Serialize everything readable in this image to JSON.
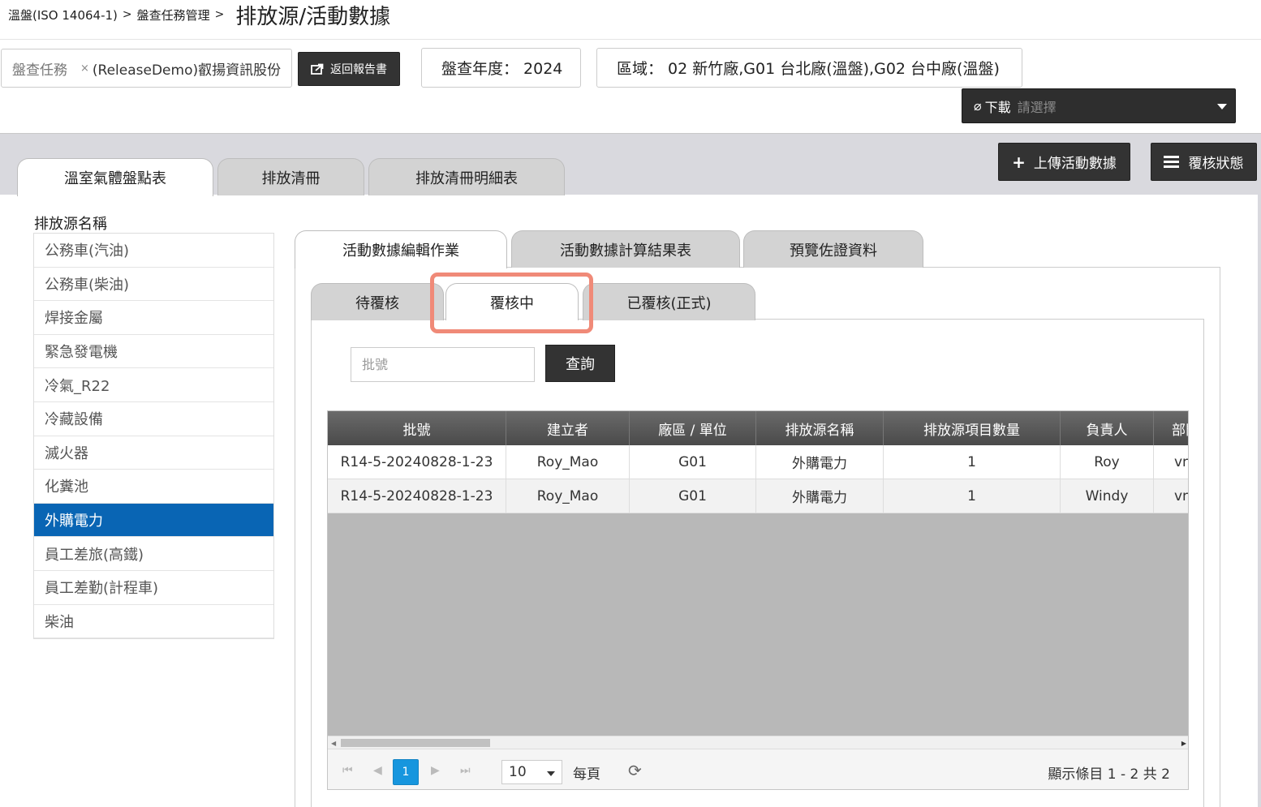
{
  "breadcrumb": {
    "item1": "溫盤(ISO 14064-1)",
    "item2": "盤查任務管理",
    "sep": ">",
    "current": "排放源/活動數據"
  },
  "task": {
    "label": "盤查任務",
    "clear_icon": "×",
    "value": "(ReleaseDemo)叡揚資訊股份"
  },
  "return_button": "返回報告書",
  "year_box": "盤查年度： 2024",
  "area_box": "區域： 02 新竹廠,G01 台北廠(溫盤),G02 台中廠(溫盤)",
  "download": {
    "label": "下載",
    "placeholder": "請選擇"
  },
  "upload_button": "上傳活動數據",
  "status_button": "覆核狀態",
  "main_tabs": [
    "溫室氣體盤點表",
    "排放清冊",
    "排放清冊明細表"
  ],
  "source_list": {
    "title": "排放源名稱",
    "items": [
      "公務車(汽油)",
      "公務車(柴油)",
      "焊接金屬",
      "緊急發電機",
      "冷氣_R22",
      "冷藏設備",
      "滅火器",
      "化糞池",
      "外購電力",
      "員工差旅(高鐵)",
      "員工差勤(計程車)",
      "柴油"
    ],
    "selected": "外購電力"
  },
  "sub_tabs": [
    "活動數據編輯作業",
    "活動數據計算結果表",
    "預覽佐證資料"
  ],
  "status_tabs": [
    "待覆核",
    "覆核中",
    "已覆核(正式)"
  ],
  "search": {
    "placeholder": "批號",
    "button": "查詢"
  },
  "grid": {
    "columns": [
      "批號",
      "建立者",
      "廠區 / 單位",
      "排放源名稱",
      "排放源項目數量",
      "負責人",
      "部門"
    ],
    "rows": [
      [
        "R14-5-20240828-1-23",
        "Roy_Mao",
        "G01",
        "外購電力",
        "1",
        "Roy",
        "vn"
      ],
      [
        "R14-5-20240828-1-23",
        "Roy_Mao",
        "G01",
        "外購電力",
        "1",
        "Windy",
        "vn"
      ]
    ]
  },
  "pager": {
    "page": "1",
    "page_size": "10",
    "per_page_label": "每頁",
    "info": "顯示條目 1 - 2 共 2"
  },
  "colors": {
    "accent": "#0965b4",
    "highlight": "#f08a78",
    "dark_button": "#333333",
    "pager_active": "#1796de"
  },
  "icons": [
    "clear-icon",
    "export-icon",
    "paperclip-icon",
    "chevron-down-icon",
    "plus-icon",
    "list-icon",
    "first-page-icon",
    "prev-page-icon",
    "next-page-icon",
    "last-page-icon",
    "refresh-icon"
  ]
}
